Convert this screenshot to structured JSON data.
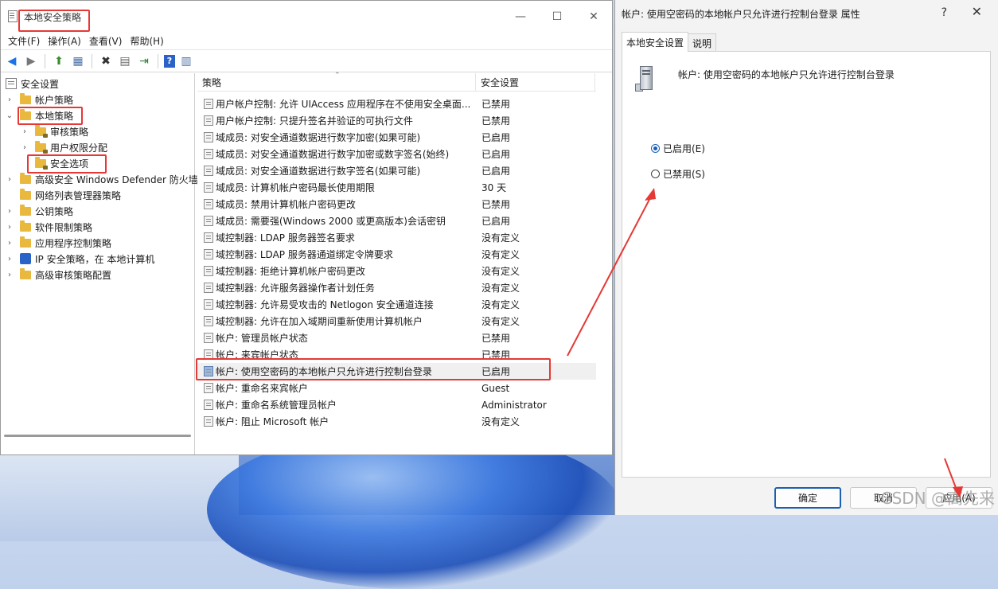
{
  "window": {
    "title": "本地安全策略",
    "minimize": "—",
    "maximize": "☐",
    "close": "✕"
  },
  "menu": [
    "文件(F)",
    "操作(A)",
    "查看(V)",
    "帮助(H)"
  ],
  "toolbar": {
    "back": "◀",
    "forward": "▶",
    "up": "⬆",
    "show_tree": "▦",
    "delete": "✖",
    "properties": "▤",
    "export": "⇥",
    "help": "?",
    "view": "▥"
  },
  "tree": [
    {
      "label": "安全设置",
      "level": 0,
      "chev": "",
      "icon": "root"
    },
    {
      "label": "帐户策略",
      "level": 1,
      "chev": "›",
      "icon": "folder"
    },
    {
      "label": "本地策略",
      "level": 1,
      "chev": "⌄",
      "icon": "folder"
    },
    {
      "label": "审核策略",
      "level": 2,
      "chev": "›",
      "icon": "folder"
    },
    {
      "label": "用户权限分配",
      "level": 2,
      "chev": "›",
      "icon": "folder"
    },
    {
      "label": "安全选项",
      "level": 2,
      "chev": "",
      "icon": "folder"
    },
    {
      "label": "高级安全 Windows Defender 防火墙",
      "level": 1,
      "chev": "›",
      "icon": "folder"
    },
    {
      "label": "网络列表管理器策略",
      "level": 1,
      "chev": "",
      "icon": "folder"
    },
    {
      "label": "公钥策略",
      "level": 1,
      "chev": "›",
      "icon": "folder"
    },
    {
      "label": "软件限制策略",
      "level": 1,
      "chev": "›",
      "icon": "folder"
    },
    {
      "label": "应用程序控制策略",
      "level": 1,
      "chev": "›",
      "icon": "folder"
    },
    {
      "label": "IP 安全策略，在 本地计算机",
      "level": 1,
      "chev": "›",
      "icon": "ip"
    },
    {
      "label": "高级审核策略配置",
      "level": 1,
      "chev": "›",
      "icon": "folder"
    }
  ],
  "list": {
    "headers": {
      "policy": "策略",
      "setting": "安全设置"
    },
    "sort_caret": "⌃",
    "rows": [
      {
        "policy": "用户帐户控制: 允许 UIAccess 应用程序在不使用安全桌面...",
        "setting": "已禁用"
      },
      {
        "policy": "用户帐户控制: 只提升签名并验证的可执行文件",
        "setting": "已禁用"
      },
      {
        "policy": "域成员: 对安全通道数据进行数字加密(如果可能)",
        "setting": "已启用"
      },
      {
        "policy": "域成员: 对安全通道数据进行数字加密或数字签名(始终)",
        "setting": "已启用"
      },
      {
        "policy": "域成员: 对安全通道数据进行数字签名(如果可能)",
        "setting": "已启用"
      },
      {
        "policy": "域成员: 计算机帐户密码最长使用期限",
        "setting": "30 天"
      },
      {
        "policy": "域成员: 禁用计算机帐户密码更改",
        "setting": "已禁用"
      },
      {
        "policy": "域成员: 需要强(Windows 2000 或更高版本)会话密钥",
        "setting": "已启用"
      },
      {
        "policy": "域控制器: LDAP 服务器签名要求",
        "setting": "没有定义"
      },
      {
        "policy": "域控制器: LDAP 服务器通道绑定令牌要求",
        "setting": "没有定义"
      },
      {
        "policy": "域控制器: 拒绝计算机帐户密码更改",
        "setting": "没有定义"
      },
      {
        "policy": "域控制器: 允许服务器操作者计划任务",
        "setting": "没有定义"
      },
      {
        "policy": "域控制器: 允许易受攻击的 Netlogon 安全通道连接",
        "setting": "没有定义"
      },
      {
        "policy": "域控制器:   允许在加入域期间重新使用计算机帐户",
        "setting": "没有定义"
      },
      {
        "policy": "帐户: 管理员帐户状态",
        "setting": "已禁用"
      },
      {
        "policy": "帐户: 来宾帐户状态",
        "setting": "已禁用"
      },
      {
        "policy": "帐户: 使用空密码的本地帐户只允许进行控制台登录",
        "setting": "已启用"
      },
      {
        "policy": "帐户: 重命名来宾帐户",
        "setting": "Guest"
      },
      {
        "policy": "帐户: 重命名系统管理员帐户",
        "setting": "Administrator"
      },
      {
        "policy": "帐户: 阻止 Microsoft 帐户",
        "setting": "没有定义"
      }
    ]
  },
  "dialog": {
    "title": "帐户: 使用空密码的本地帐户只允许进行控制台登录 属性",
    "help": "?",
    "close": "✕",
    "tabs": [
      "本地安全设置",
      "说明"
    ],
    "policy_name": "帐户: 使用空密码的本地帐户只允许进行控制台登录",
    "options": [
      {
        "label": "已启用(E)",
        "checked": true
      },
      {
        "label": "已禁用(S)",
        "checked": false
      }
    ],
    "buttons": {
      "ok": "确定",
      "cancel": "取消",
      "apply": "应用(A)"
    }
  },
  "watermark": "CSDN @高先来",
  "colors": {
    "annotation": "#e53935",
    "accent": "#1a5fb4"
  }
}
